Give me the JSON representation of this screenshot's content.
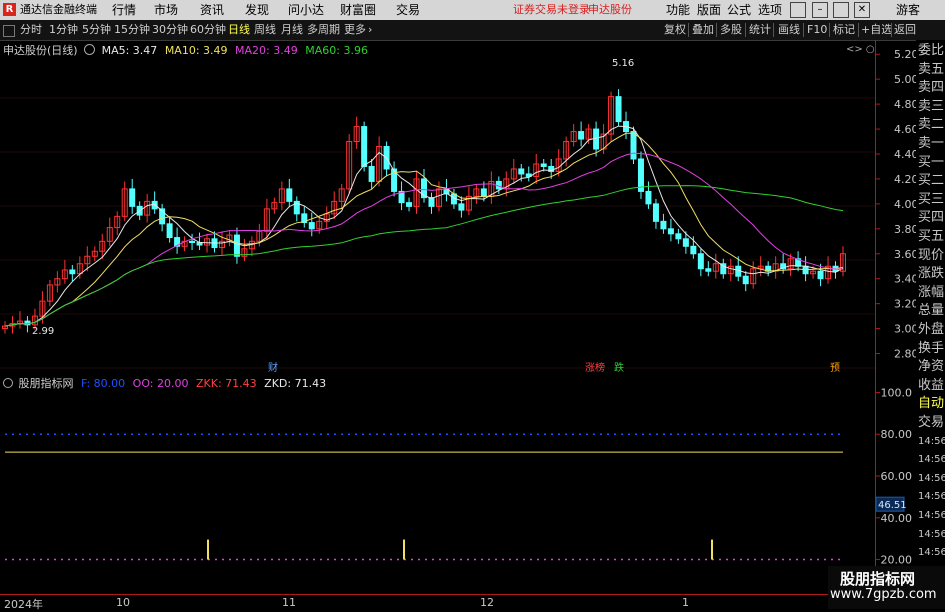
{
  "menubar": {
    "app_icon": "R",
    "app_title": "通达信金融终端",
    "items": [
      "行情",
      "市场",
      "资讯",
      "发现",
      "问小达",
      "财富圈",
      "交易"
    ],
    "status_text": "证券交易未登录",
    "stock_name": "申达股份",
    "right_items": [
      "功能",
      "版面",
      "公式",
      "选项"
    ],
    "user": "游客",
    "window_buttons": [
      "minimize-icon",
      "maximize-icon",
      "close-icon"
    ]
  },
  "toolbar": {
    "periods": [
      "分时",
      "1分钟",
      "5分钟",
      "15分钟",
      "30分钟",
      "60分钟",
      "日线",
      "周线",
      "月线",
      "多周期",
      "更多"
    ],
    "active_period": "日线",
    "right_buttons": [
      "复权",
      "叠加",
      "多股",
      "统计",
      "画线",
      "F10",
      "标记",
      "+自选",
      "返回"
    ]
  },
  "main_chart": {
    "title": "申达股份(日线)",
    "legend": [
      {
        "label": "MA5: 3.47",
        "color": "#e8e8e8"
      },
      {
        "label": "MA10: 3.49",
        "color": "#f0e060"
      },
      {
        "label": "MA20: 3.49",
        "color": "#e040e0"
      },
      {
        "label": "MA60: 3.96",
        "color": "#30d030"
      }
    ],
    "y_ticks": [
      "5.20",
      "5.00",
      "4.80",
      "4.60",
      "4.40",
      "4.20",
      "4.00",
      "3.80",
      "3.60",
      "3.40",
      "3.20",
      "3.00",
      "2.80"
    ],
    "high_label": "5.16",
    "low_label": "2.99",
    "event_marks": [
      {
        "text": "财",
        "color": "#5aa0ff"
      },
      {
        "text": "涨榜",
        "color": "#ff4040"
      },
      {
        "text": "跌",
        "color": "#30d030"
      },
      {
        "text": "预",
        "color": "#ffa000"
      }
    ]
  },
  "indicator": {
    "name": "股朋指标网",
    "legend": [
      {
        "label": "F: 80.00",
        "color": "#2050ff"
      },
      {
        "label": "OO: 20.00",
        "color": "#e040e0"
      },
      {
        "label": "ZKK: 71.43",
        "color": "#ff4040"
      },
      {
        "label": "ZKD: 71.43",
        "color": "#e8e8e8"
      }
    ],
    "y_ticks": [
      "100.0",
      "80.00",
      "60.00",
      "46.51",
      "40.00",
      "20.00"
    ],
    "current_value": "46.51"
  },
  "side_panel": [
    "委比",
    "卖五",
    "卖四",
    "卖三",
    "卖二",
    "卖一",
    "买一",
    "买二",
    "买三",
    "买四",
    "买五",
    "现价",
    "涨跌",
    "涨幅",
    "总量",
    "外盘",
    "换手",
    "净资",
    "收益",
    "自动",
    "交易",
    "14:56",
    "14:56",
    "14:56",
    "14:56",
    "14:56",
    "14:56",
    "14:56",
    "14:56",
    "14:56"
  ],
  "x_axis": [
    "2024年",
    "10",
    "11",
    "12",
    "1"
  ],
  "watermark": {
    "line1": "股朋指标网",
    "line2": "www.7gpzb.com"
  },
  "chart_data": [
    {
      "type": "candlestick",
      "title": "申达股份(日线)",
      "ylim": [
        2.7,
        5.25
      ],
      "series": [
        {
          "name": "price_closes",
          "values": [
            3.02,
            3.04,
            3.06,
            3.03,
            3.1,
            3.22,
            3.35,
            3.4,
            3.47,
            3.44,
            3.52,
            3.58,
            3.62,
            3.7,
            3.81,
            3.9,
            4.12,
            3.98,
            3.91,
            4.02,
            3.96,
            3.84,
            3.73,
            3.66,
            3.7,
            3.69,
            3.67,
            3.72,
            3.65,
            3.7,
            3.75,
            3.58,
            3.64,
            3.7,
            3.78,
            3.96,
            4.01,
            4.12,
            4.02,
            3.92,
            3.85,
            3.8,
            3.86,
            3.92,
            4.02,
            4.12,
            4.5,
            4.62,
            4.3,
            4.18,
            4.46,
            4.28,
            4.1,
            4.01,
            3.98,
            4.2,
            4.05,
            3.98,
            4.12,
            4.08,
            4.0,
            3.95,
            4.06,
            4.12,
            4.06,
            4.18,
            4.12,
            4.2,
            4.28,
            4.24,
            4.22,
            4.32,
            4.3,
            4.26,
            4.36,
            4.5,
            4.58,
            4.52,
            4.6,
            4.44,
            4.56,
            4.86,
            4.66,
            4.58,
            4.36,
            4.1,
            4.0,
            3.86,
            3.8,
            3.76,
            3.72,
            3.66,
            3.6,
            3.48,
            3.46,
            3.52,
            3.44,
            3.5,
            3.42,
            3.36,
            3.48,
            3.5,
            3.46,
            3.52,
            3.48,
            3.56,
            3.5,
            3.44,
            3.46,
            3.4,
            3.5,
            3.46,
            3.6
          ]
        }
      ]
    },
    {
      "type": "line",
      "title": "股朋指标网",
      "ylim": [
        15,
        105
      ],
      "series": [
        {
          "name": "F",
          "values": [
            80.0
          ]
        },
        {
          "name": "OO",
          "values": [
            20.0
          ]
        },
        {
          "name": "ZKK",
          "values": [
            71.43
          ]
        },
        {
          "name": "ZKD",
          "values": [
            71.43
          ]
        }
      ]
    }
  ]
}
